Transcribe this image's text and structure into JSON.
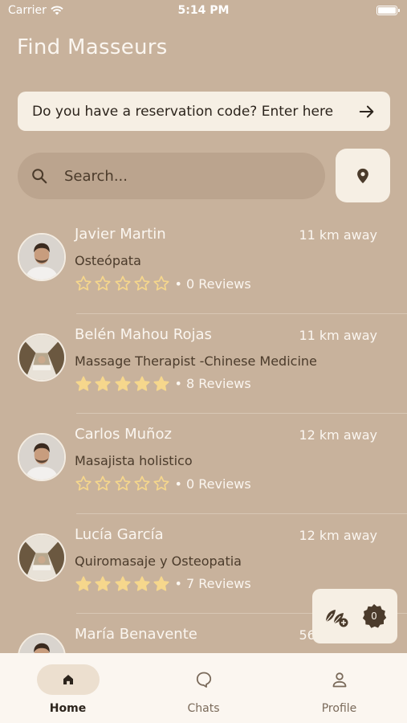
{
  "status_bar": {
    "carrier": "Carrier",
    "time": "5:14 PM"
  },
  "page": {
    "title": "Find Masseurs"
  },
  "reservation": {
    "text": "Do you have a reservation code? Enter here"
  },
  "search": {
    "placeholder": "Search..."
  },
  "colors": {
    "background": "#c8b29c",
    "card": "#f6efe4",
    "star_fill": "#f6d78c",
    "star_outline": "#f6d78c",
    "text_light": "#fbf6f0",
    "text_dark": "#4b3b2b"
  },
  "masseurs": [
    {
      "name": "Javier Martin",
      "distance": "11 km away",
      "specialty": "Osteópata",
      "rating": 0,
      "reviews": "• 0 Reviews",
      "avatar": "man-portrait"
    },
    {
      "name": "Belén Mahou Rojas",
      "distance": "11 km away",
      "specialty": "Massage Therapist -Chinese Medicine",
      "rating": 5,
      "reviews": "• 8 Reviews",
      "avatar": "room-photo"
    },
    {
      "name": "Carlos Muñoz",
      "distance": "12 km away",
      "specialty": "Masajista holistico",
      "rating": 0,
      "reviews": "• 0 Reviews",
      "avatar": "man-portrait"
    },
    {
      "name": "Lucía García",
      "distance": "12 km away",
      "specialty": "Quiromasaje y Osteopatia",
      "rating": 5,
      "reviews": "• 7 Reviews",
      "avatar": "room-photo"
    },
    {
      "name": "María Benavente",
      "distance": "56 km away",
      "specialty": "",
      "rating": 0,
      "reviews": "",
      "avatar": "man-portrait"
    }
  ],
  "floating_widget": {
    "icon": "leaves-add-icon",
    "count": "0"
  },
  "tabs": [
    {
      "label": "Home",
      "icon": "home-icon",
      "active": true
    },
    {
      "label": "Chats",
      "icon": "chat-icon",
      "active": false
    },
    {
      "label": "Profile",
      "icon": "profile-icon",
      "active": false
    }
  ]
}
